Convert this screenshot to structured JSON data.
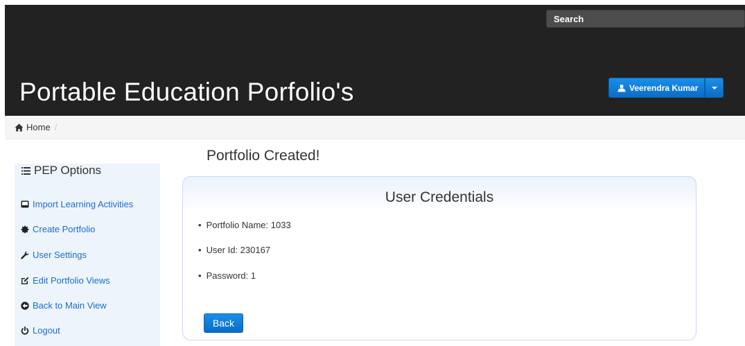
{
  "header": {
    "app_title": "Portable Education Porfolio's",
    "search": {
      "placeholder": "Search",
      "value": ""
    },
    "user_menu": {
      "label": "Veerendra Kumar",
      "icon": "user-icon"
    }
  },
  "breadcrumb": {
    "home_label": "Home",
    "separator": "/"
  },
  "sidebar": {
    "title": "PEP Options",
    "items": [
      {
        "label": "Import Learning Activities",
        "icon": "hdd-icon"
      },
      {
        "label": "Create Portfolio",
        "icon": "certificate-icon"
      },
      {
        "label": "User Settings",
        "icon": "wrench-icon"
      },
      {
        "label": "Edit Portfolio Views",
        "icon": "edit-icon"
      },
      {
        "label": "Back to Main View",
        "icon": "back-circle-icon"
      },
      {
        "label": "Logout",
        "icon": "power-icon"
      }
    ]
  },
  "main": {
    "heading": "Portfolio Created!",
    "panel": {
      "title": "User Credentials",
      "credentials": [
        {
          "text": "Portfolio Name: 1033"
        },
        {
          "text": "User Id: 230167"
        },
        {
          "text": "Password: 1"
        }
      ],
      "back_label": "Back"
    }
  },
  "colors": {
    "accent": "#0a6cc8",
    "link": "#1a6ec7",
    "header_bg": "#222222",
    "sidebar_bg": "#eef4fc"
  }
}
